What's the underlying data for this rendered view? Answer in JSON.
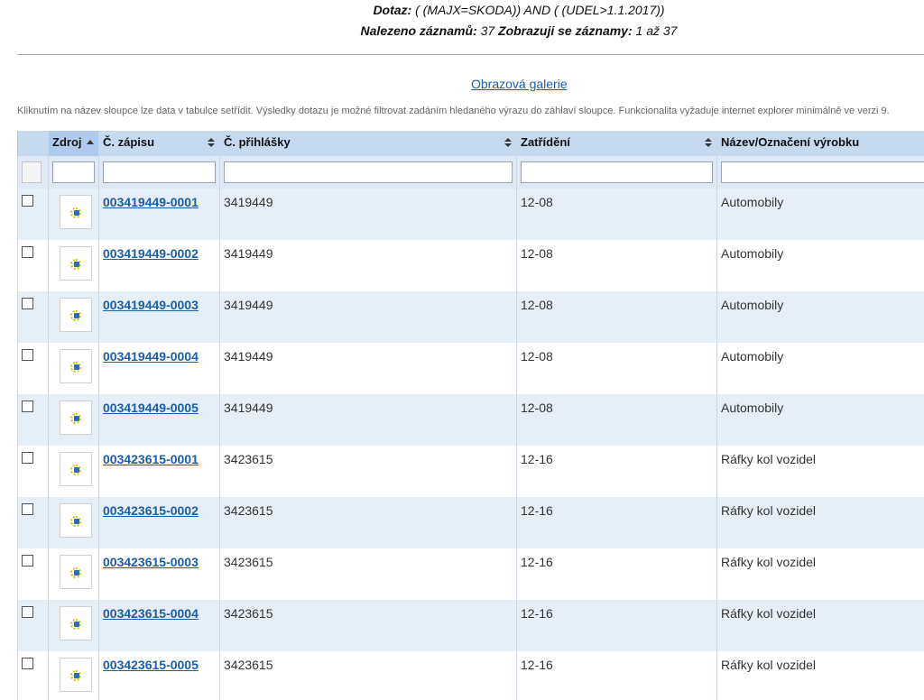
{
  "query": {
    "label": "Dotaz:",
    "value": "( (MAJX=SKODA)) AND ( (UDEL>1.1.2017))",
    "found_label": "Nalezeno záznamů:",
    "found_value": "37",
    "showing_label": "Zobrazuji se záznamy:",
    "showing_value": "1 až 37"
  },
  "gallery_link": "Obrazová galerie",
  "hint": "Kliknutím na název sloupce lze data v tabulce setřídit. Výsledky dotazu je možné filtrovat zadáním hledaného výrazu do záhlaví sloupce. Funkcionalita vyžaduje internet explorer minimálně ve verzi 9.",
  "columns": {
    "source": "Zdroj",
    "reg_no": "Č. zápisu",
    "app_no": "Č. přihlášky",
    "class": "Zatřídění",
    "name": "Název/Označení výrobku"
  },
  "sort": {
    "column": "source",
    "direction": "ascending"
  },
  "rows": [
    {
      "reg_no": "003419449-0001",
      "app_no": "3419449",
      "class": "12-08",
      "name": "Automobily"
    },
    {
      "reg_no": "003419449-0002",
      "app_no": "3419449",
      "class": "12-08",
      "name": "Automobily"
    },
    {
      "reg_no": "003419449-0003",
      "app_no": "3419449",
      "class": "12-08",
      "name": "Automobily"
    },
    {
      "reg_no": "003419449-0004",
      "app_no": "3419449",
      "class": "12-08",
      "name": "Automobily"
    },
    {
      "reg_no": "003419449-0005",
      "app_no": "3419449",
      "class": "12-08",
      "name": "Automobily"
    },
    {
      "reg_no": "003423615-0001",
      "app_no": "3423615",
      "class": "12-16",
      "name": "Ráfky kol vozidel"
    },
    {
      "reg_no": "003423615-0002",
      "app_no": "3423615",
      "class": "12-16",
      "name": "Ráfky kol vozidel"
    },
    {
      "reg_no": "003423615-0003",
      "app_no": "3423615",
      "class": "12-16",
      "name": "Ráfky kol vozidel"
    },
    {
      "reg_no": "003423615-0004",
      "app_no": "3423615",
      "class": "12-16",
      "name": "Ráfky kol vozidel"
    },
    {
      "reg_no": "003423615-0005",
      "app_no": "3423615",
      "class": "12-16",
      "name": "Ráfky kol vozidel"
    }
  ],
  "icons": {
    "source_thumbnail": "eu-design-source-icon",
    "sort": "sort-arrows-icon"
  },
  "colors": {
    "link": "#1a5fa8",
    "header_bg": "#c6d9ef",
    "row_alt_bg": "#e6eef7"
  }
}
